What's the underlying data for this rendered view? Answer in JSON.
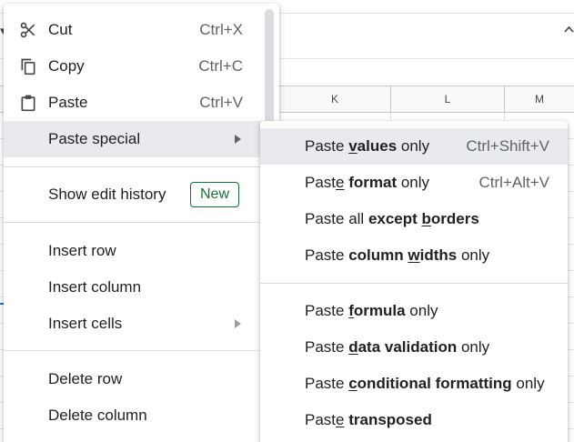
{
  "sheet": {
    "column_headers": [
      "K",
      "L",
      "M"
    ]
  },
  "context_menu": {
    "items": [
      {
        "label": "Cut",
        "shortcut": "Ctrl+X",
        "icon": "scissors-icon"
      },
      {
        "label": "Copy",
        "shortcut": "Ctrl+C",
        "icon": "copy-icon"
      },
      {
        "label": "Paste",
        "shortcut": "Ctrl+V",
        "icon": "clipboard-icon"
      },
      {
        "label": "Paste special",
        "has_submenu": true,
        "highlighted": true
      },
      {
        "label": "Show edit history",
        "badge": "New"
      },
      {
        "label": "Insert row"
      },
      {
        "label": "Insert column"
      },
      {
        "label": "Insert cells",
        "has_submenu": true
      },
      {
        "label": "Delete row"
      },
      {
        "label": "Delete column"
      }
    ]
  },
  "paste_special_submenu": {
    "items": [
      {
        "pre": "Paste ",
        "u": "v",
        "bold": "alues",
        "post": " only",
        "shortcut": "Ctrl+Shift+V",
        "highlighted": true
      },
      {
        "pre": "Past",
        "u": "e",
        "bold": " format",
        "post": " only",
        "shortcut": "Ctrl+Alt+V"
      },
      {
        "pre": "Paste all ",
        "bold": "except ",
        "u": "b",
        "bold2": "orders",
        "post": ""
      },
      {
        "pre": "Paste ",
        "bold": "column ",
        "u": "w",
        "bold2": "idths",
        "post": " only"
      },
      {
        "pre": "Paste ",
        "u": "f",
        "bold": "ormula",
        "post": " only"
      },
      {
        "pre": "Paste ",
        "u": "d",
        "bold": "ata validation",
        "post": " only"
      },
      {
        "pre": "Paste ",
        "u": "c",
        "bold": "onditional formatting",
        "post": " only"
      },
      {
        "pre": "Past",
        "u": "e",
        "bold": " transposed",
        "post": ""
      }
    ]
  }
}
